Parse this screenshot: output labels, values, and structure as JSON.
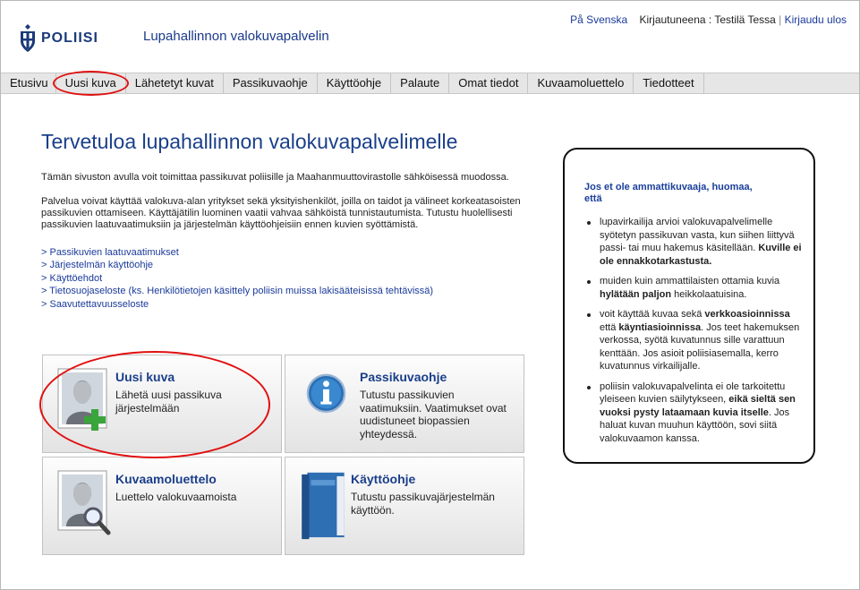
{
  "header": {
    "logo_text": "POLIISI",
    "site_title": "Lupahallinnon valokuvapalvelin",
    "lang_link": "På Svenska",
    "logged_in_label": "Kirjautuneena : Testilä Tessa",
    "logout_link": "Kirjaudu ulos"
  },
  "nav": {
    "items": [
      {
        "label": "Etusivu"
      },
      {
        "label": "Uusi kuva",
        "highlighted": true
      },
      {
        "label": "Lähetetyt kuvat"
      },
      {
        "label": "Passikuvaohje"
      },
      {
        "label": "Käyttöohje"
      },
      {
        "label": "Palaute"
      },
      {
        "label": "Omat tiedot"
      },
      {
        "label": "Kuvaamoluettelo"
      },
      {
        "label": "Tiedotteet"
      }
    ]
  },
  "main": {
    "title": "Tervetuloa lupahallinnon valokuvapalvelimelle",
    "intro": "Tämän sivuston avulla voit toimittaa passikuvat poliisille ja Maahanmuuttovirastolle sähköisessä muodossa.",
    "body": "Palvelua voivat käyttää valokuva-alan yritykset sekä yksityishenkilöt, joilla on taidot ja välineet korkeatasoisten passikuvien ottamiseen. Käyttäjätilin luominen vaatii vahvaa sähköistä tunnistautumista. Tutustu huolellisesti passikuvien laatuvaatimuksiin ja järjestelmän käyttöohjeisiin ennen kuvien syöttämistä.",
    "links": [
      "> Passikuvien laatuvaatimukset",
      "> Järjestelmän käyttöohje",
      "> Käyttöehdot",
      "> Tietosuojaseloste (ks. Henkilötietojen käsittely poliisin muissa lakisääteisissä tehtävissä)",
      "> Saavutettavuusseloste"
    ]
  },
  "infobox": {
    "heading": "Jos et ole ammattikuvaaja, huomaa, että",
    "items": [
      [
        "lupavirkailija arvioi valokuvapalvelimelle syötetyn passikuvan vasta, kun siihen liittyvä passi- tai muu hakemus käsitellään. ",
        "Kuville ei ole ennakkotarkastusta.",
        ""
      ],
      [
        "muiden kuin ammattilaisten ottamia kuvia ",
        "hylätään paljon",
        " heikkolaatuisina."
      ],
      [
        "voit käyttää kuvaa sekä ",
        "verkkoasioinnissa",
        " että "
      ],
      [
        "poliisin valokuvapalvelinta ei ole tarkoitettu yleiseen kuvien säilytykseen, ",
        "eikä sieltä sen vuoksi pysty lataamaan kuvia itselle",
        ". Jos haluat kuvan muuhun käyttöön, sovi siitä valokuvaamon kanssa."
      ]
    ],
    "item3_bold2": "käyntiasioinnissa",
    "item3_rest": ". Jos teet hakemuksen verkossa, syötä kuvatunnus sille varattuun kenttään. Jos asioit poliisiasemalla, kerro kuvatunnus virkailijalle."
  },
  "tiles": [
    {
      "title": "Uusi kuva",
      "desc": "Lähetä uusi passikuva järjestelmään",
      "icon": "new-photo-icon"
    },
    {
      "title": "Passikuvaohje",
      "desc": "Tutustu passikuvien vaatimuksiin. Vaatimukset ovat uudistuneet biopassien yhteydessä.",
      "icon": "info-icon"
    },
    {
      "title": "Kuvaamoluettelo",
      "desc": "Luettelo valokuvaamoista",
      "icon": "search-photo-icon"
    },
    {
      "title": "Käyttöohje",
      "desc": "Tutustu passikuvajärjestelmän käyttöön.",
      "icon": "book-icon"
    }
  ],
  "colors": {
    "brand_blue": "#1a3f8a",
    "highlight_red": "#e01010",
    "nav_bg": "#e6e6e6"
  }
}
